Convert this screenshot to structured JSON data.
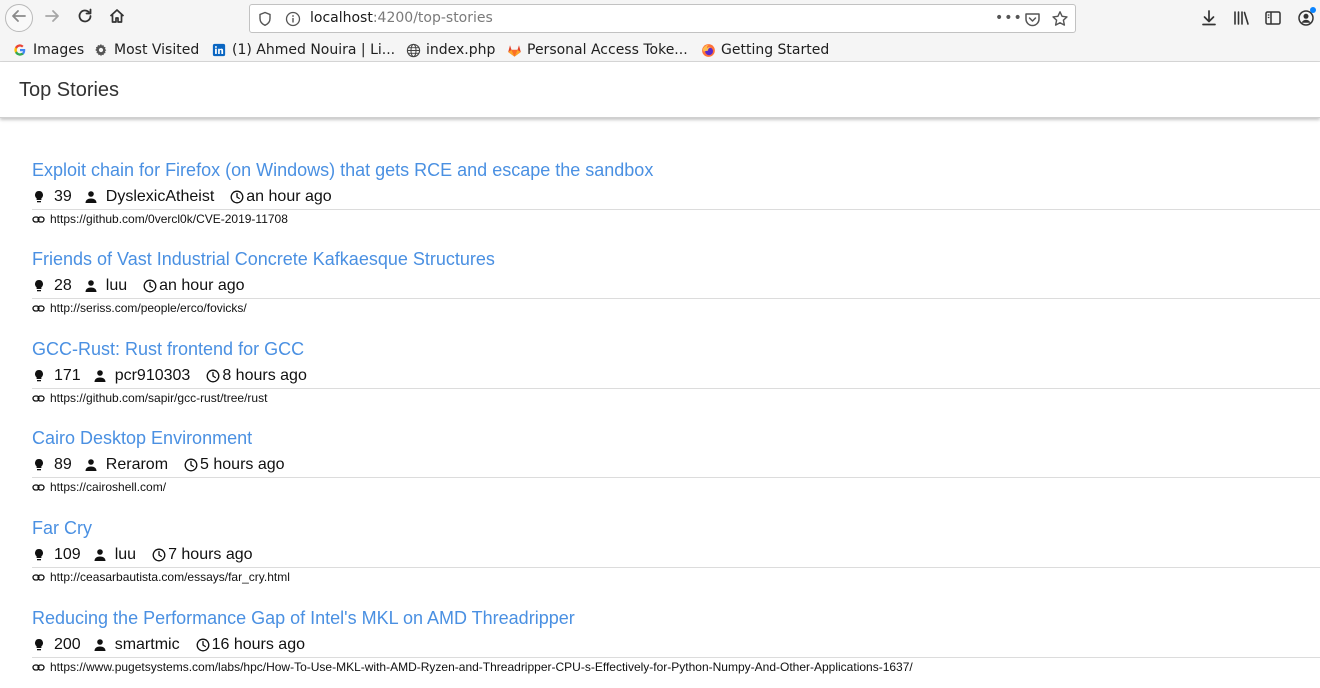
{
  "browser": {
    "url_host": "localhost",
    "url_path": ":4200/top-stories",
    "page_actions": "•••",
    "accent": "#0a84ff"
  },
  "bookmarks": [
    {
      "label": "Images",
      "icon": "google-icon"
    },
    {
      "label": "Most Visited",
      "icon": "gear-icon"
    },
    {
      "label": "(1) Ahmed Nouira | Li...",
      "icon": "linkedin-icon"
    },
    {
      "label": "index.php",
      "icon": "globe-icon"
    },
    {
      "label": "Personal Access Toke...",
      "icon": "gitlab-icon"
    },
    {
      "label": "Getting Started",
      "icon": "firefox-icon"
    }
  ],
  "app": {
    "title": "Top Stories",
    "link_color": "#4a90e2"
  },
  "stories": [
    {
      "title": "Exploit chain for Firefox (on Windows) that gets RCE and escape the sandbox",
      "points": "39",
      "author": "DyslexicAtheist",
      "time": "an hour ago",
      "url": "https://github.com/0vercl0k/CVE-2019-11708"
    },
    {
      "title": "Friends of Vast Industrial Concrete Kafkaesque Structures",
      "points": "28",
      "author": "luu",
      "time": "an hour ago",
      "url": "http://seriss.com/people/erco/fovicks/"
    },
    {
      "title": "GCC-Rust: Rust frontend for GCC",
      "points": "171",
      "author": "pcr910303",
      "time": "8 hours ago",
      "url": "https://github.com/sapir/gcc-rust/tree/rust"
    },
    {
      "title": "Cairo Desktop Environment",
      "points": "89",
      "author": "Rerarom",
      "time": "5 hours ago",
      "url": "https://cairoshell.com/"
    },
    {
      "title": "Far Cry",
      "points": "109",
      "author": "luu",
      "time": "7 hours ago",
      "url": "http://ceasarbautista.com/essays/far_cry.html"
    },
    {
      "title": "Reducing the Performance Gap of Intel's MKL on AMD Threadripper",
      "points": "200",
      "author": "smartmic",
      "time": "16 hours ago",
      "url": "https://www.pugetsystems.com/labs/hpc/How-To-Use-MKL-with-AMD-Ryzen-and-Threadripper-CPU-s-Effectively-for-Python-Numpy-And-Other-Applications-1637/"
    }
  ]
}
